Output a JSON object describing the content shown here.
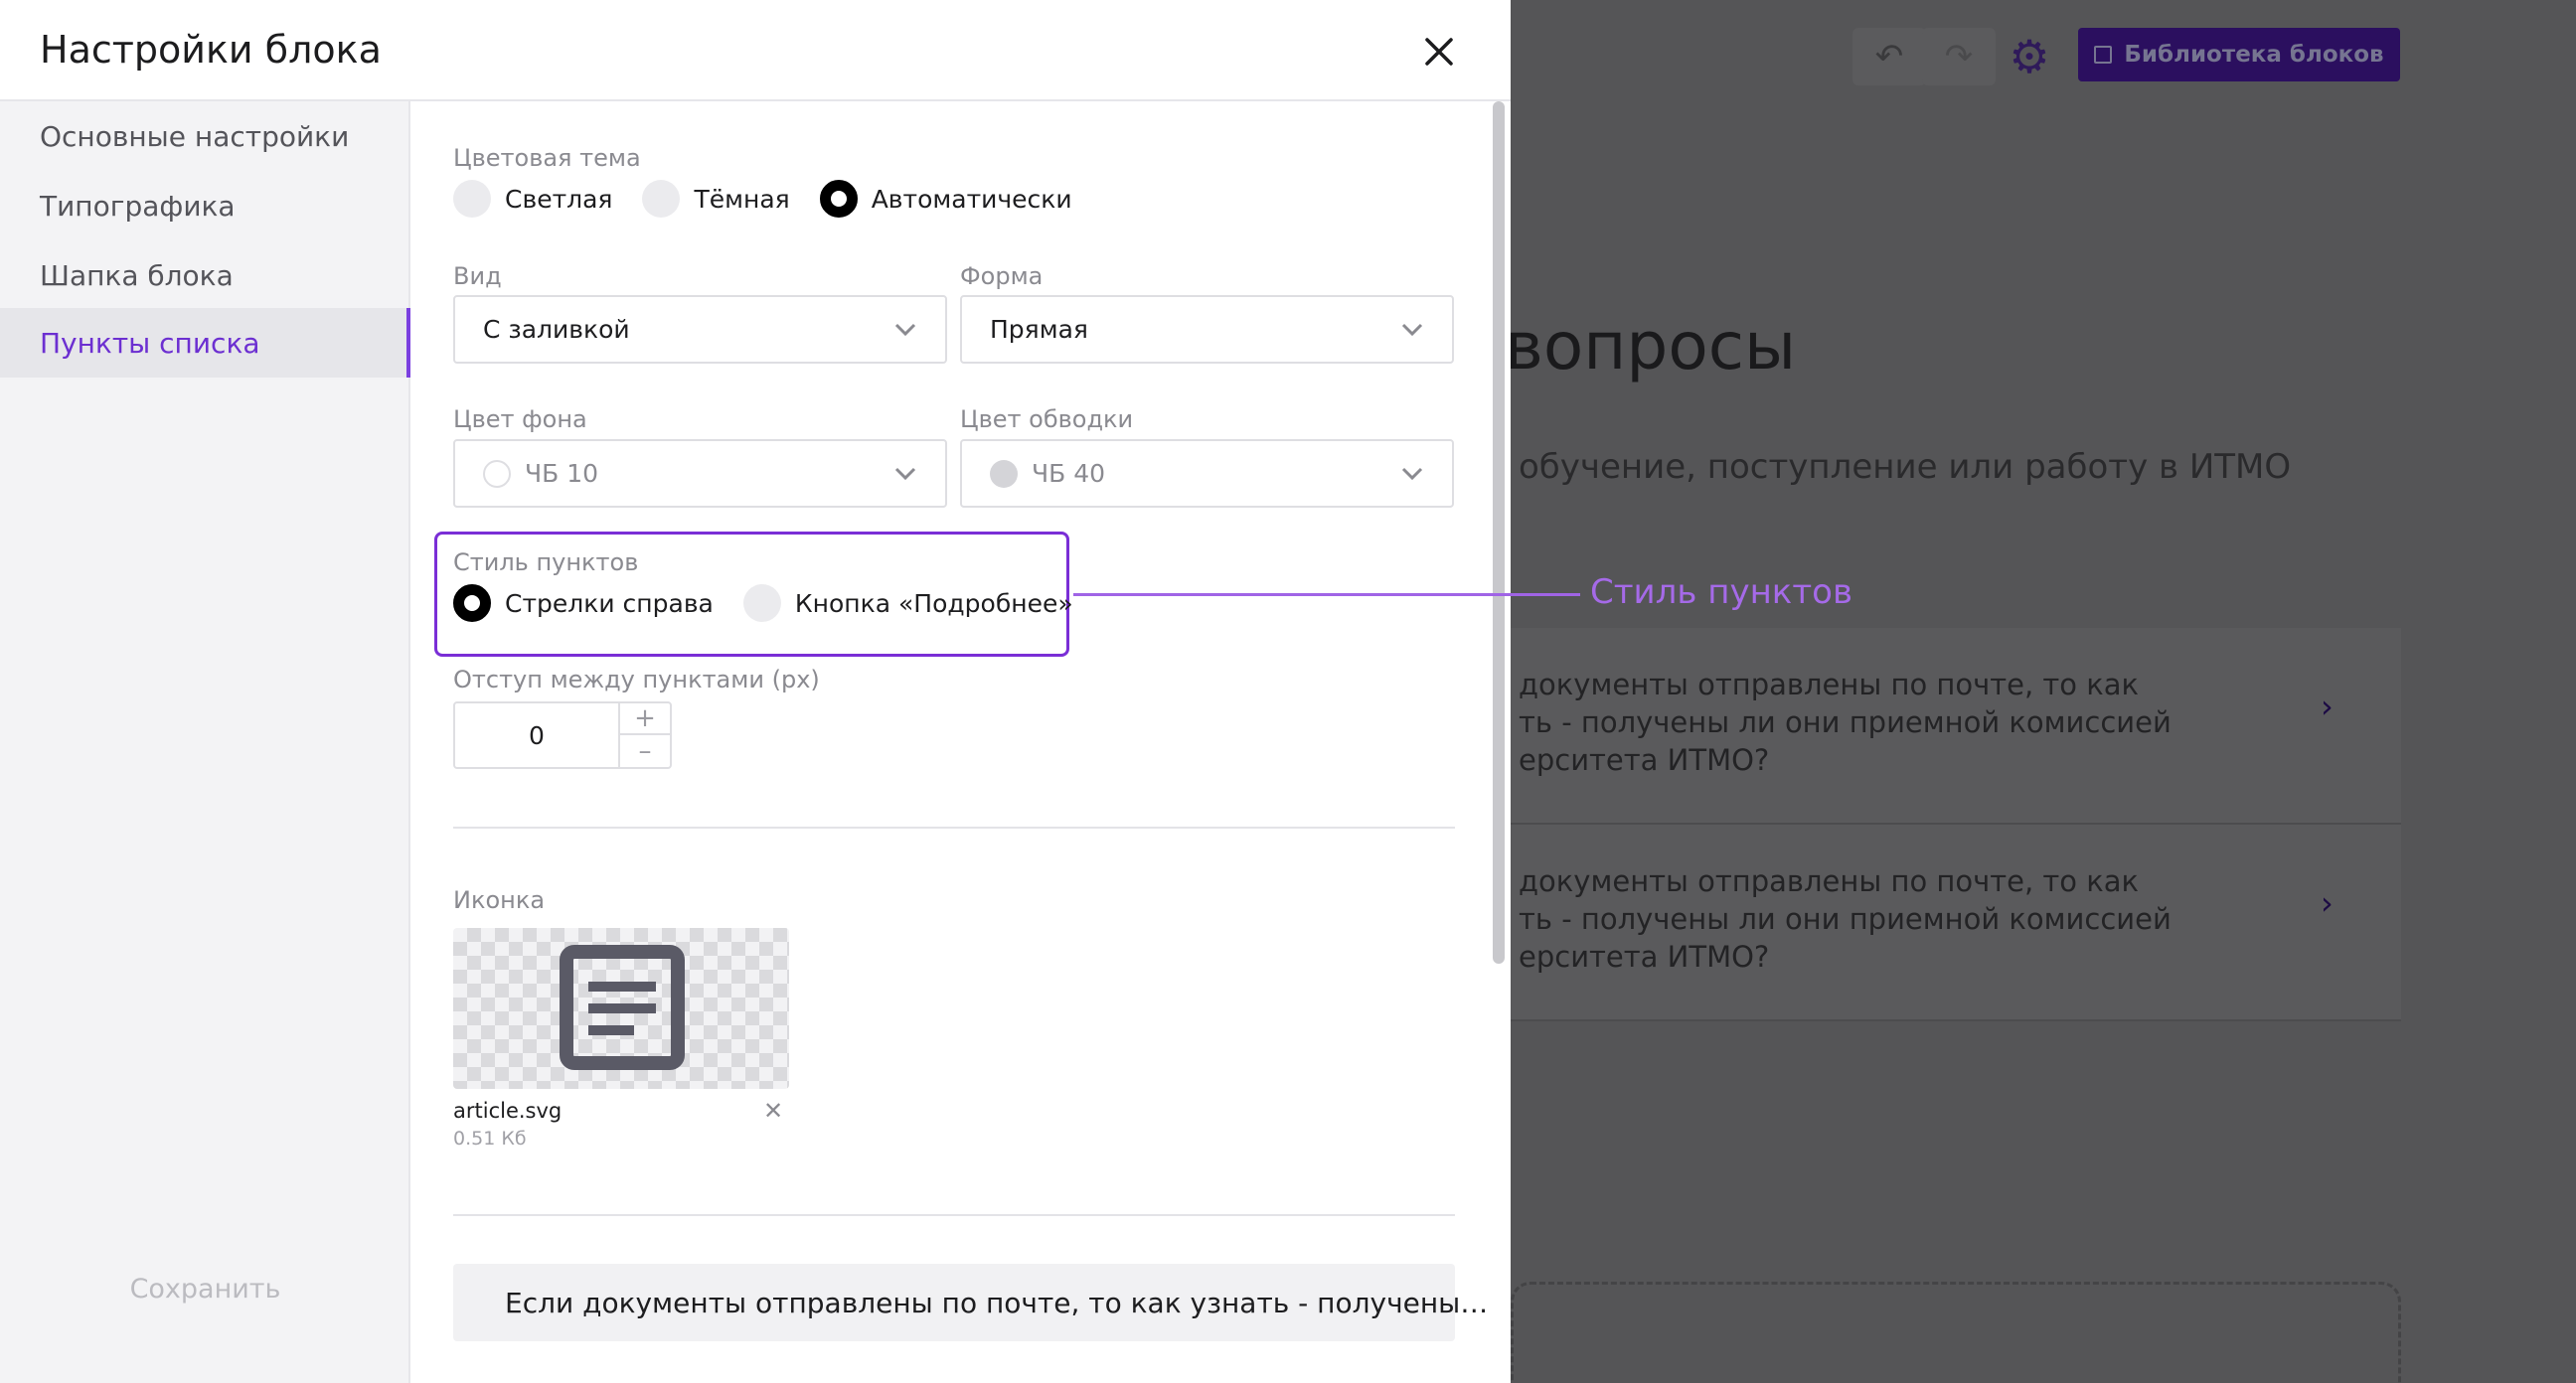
{
  "background_app": {
    "toolbar": {
      "undo_icon": "undo-icon",
      "redo_icon": "redo-icon",
      "settings_icon": "gear-icon",
      "library_button_label": "Библиотека блоков"
    },
    "heading": "вопросы",
    "subtitle": "обучение, поступление или работу в ИТМО",
    "cards": [
      {
        "text": "документы отправлены по почте, то как\nть - получены ли они приемной комиссией\nерситета ИТМО?"
      },
      {
        "text": "документы отправлены по почте, то как\nть - получены ли они приемной комиссией\nерситета ИТМО?"
      }
    ]
  },
  "modal": {
    "title": "Настройки блока",
    "close_icon": "close-icon",
    "sidebar": {
      "items": [
        {
          "label": "Основные настройки",
          "active": false
        },
        {
          "label": "Типографика",
          "active": false
        },
        {
          "label": "Шапка блока",
          "active": false
        },
        {
          "label": "Пункты списка",
          "active": true
        }
      ],
      "save_label": "Сохранить"
    },
    "form": {
      "color_theme": {
        "label": "Цветовая тема",
        "options": [
          "Светлая",
          "Тёмная",
          "Автоматически"
        ],
        "selected": "Автоматически"
      },
      "view": {
        "label": "Вид",
        "value": "С заливкой"
      },
      "shape": {
        "label": "Форма",
        "value": "Прямая"
      },
      "bg_color": {
        "label": "Цвет фона",
        "value": "ЧБ 10",
        "swatch": "#ffffff"
      },
      "border_color": {
        "label": "Цвет обводки",
        "value": "ЧБ 40",
        "swatch": "#d4d4d8"
      },
      "item_style": {
        "label": "Стиль пунктов",
        "options": [
          "Стрелки справа",
          "Кнопка «Подробнее»"
        ],
        "selected": "Стрелки справа"
      },
      "spacing": {
        "label": "Отступ между пунктами (px)",
        "value": "0",
        "plus": "+",
        "minus": "–"
      },
      "icon": {
        "label": "Иконка",
        "preview_icon": "article-icon",
        "file_name": "article.svg",
        "file_size": "0.51 Кб",
        "remove_icon": "close-icon"
      },
      "accordion_item": "Если документы отправлены по почте, то как узнать - получены…"
    }
  },
  "callout": {
    "text": "Стиль пунктов"
  },
  "colors": {
    "accent": "#6c2fd1",
    "callout": "#a56ae8",
    "library_button": "#2b0f5f"
  }
}
